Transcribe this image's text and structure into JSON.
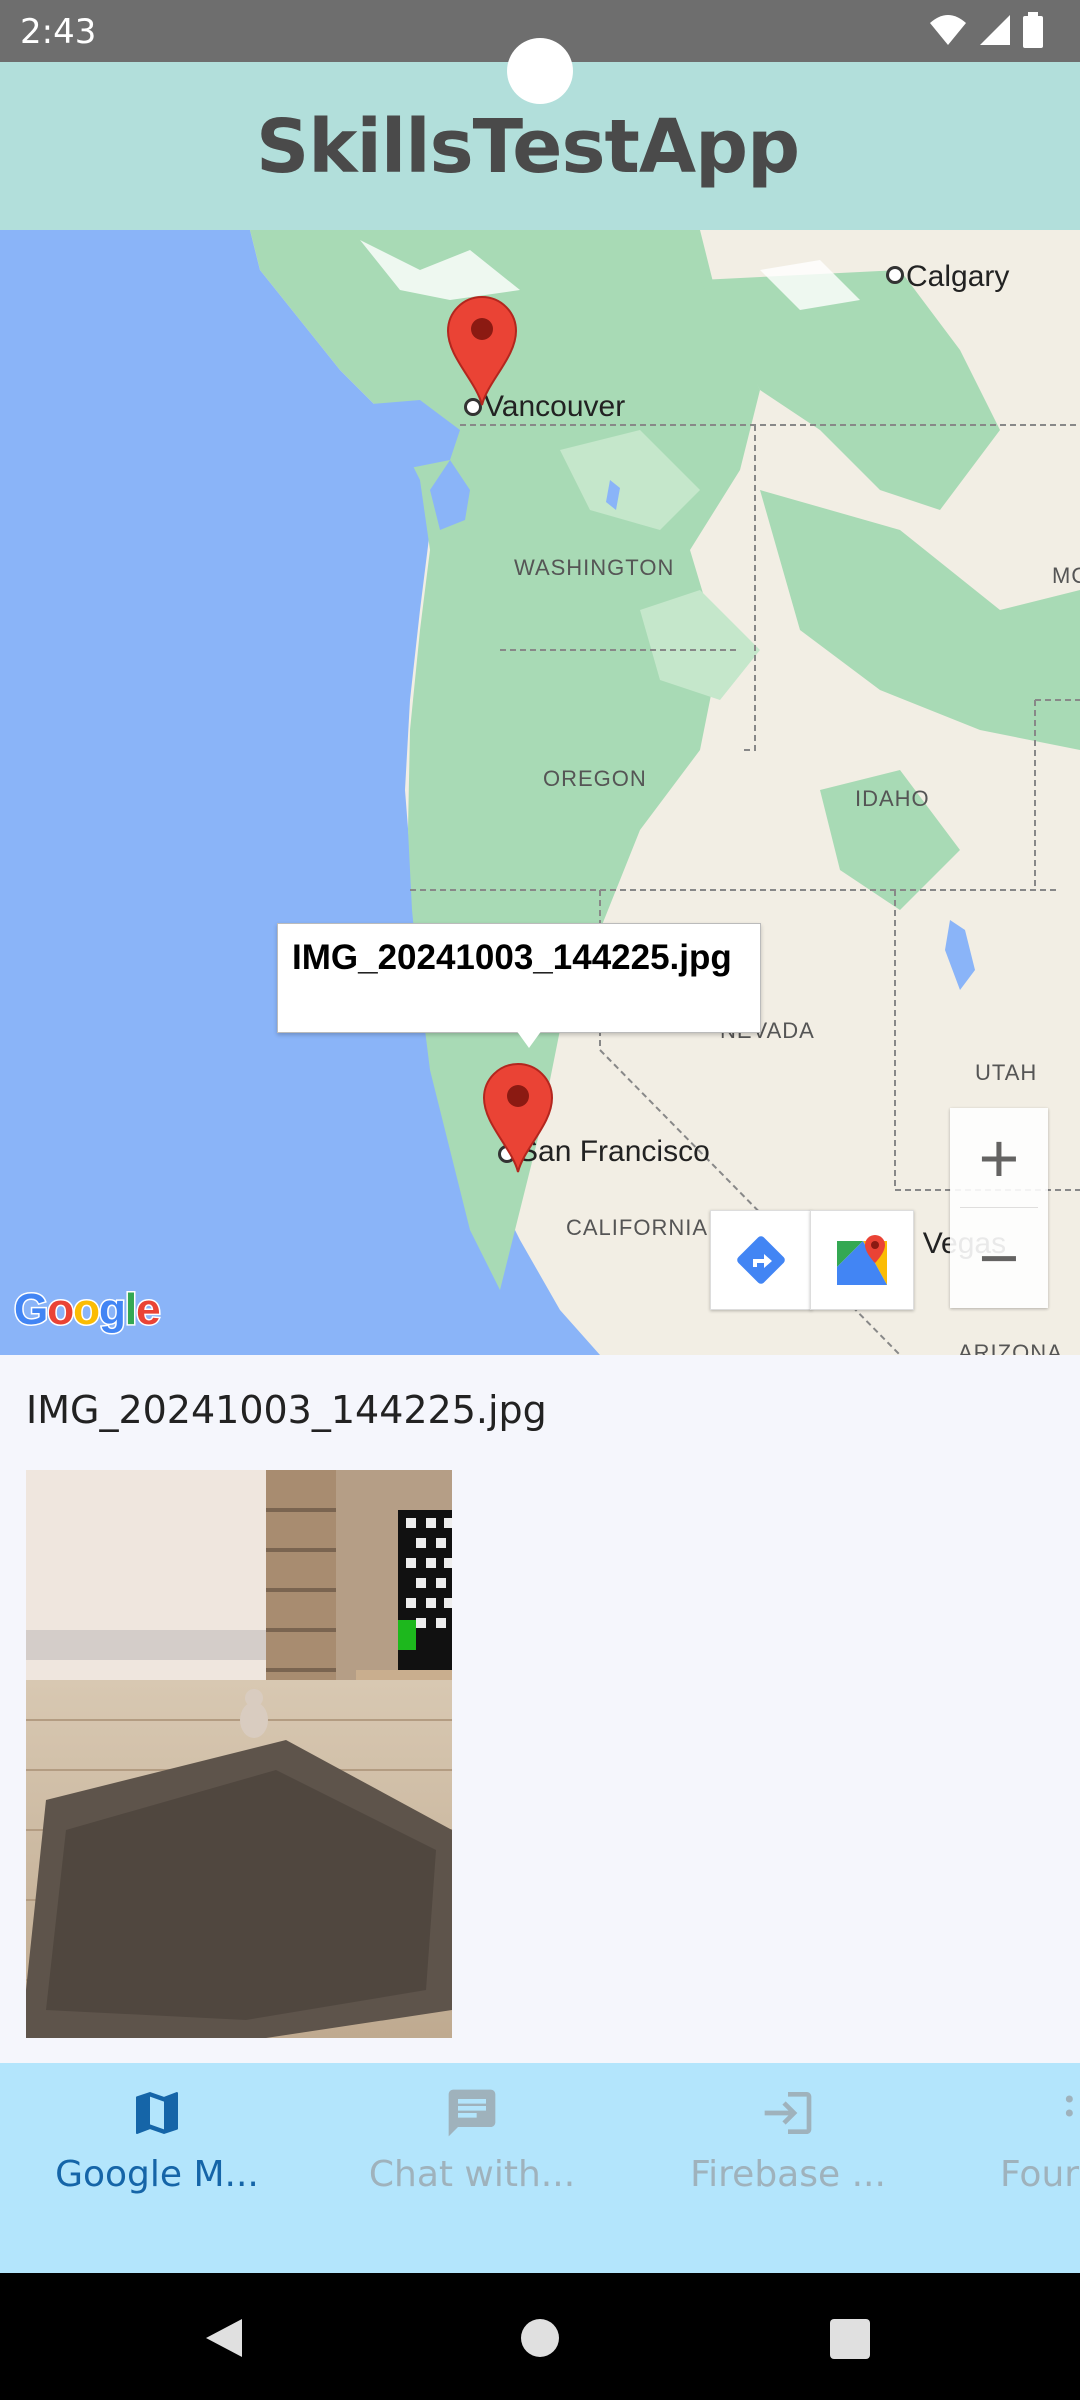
{
  "status_bar": {
    "time": "2:43"
  },
  "app_bar": {
    "title": "SkillsTestApp"
  },
  "map": {
    "cities": {
      "calgary": "Calgary",
      "vancouver": "Vancouver",
      "san_francisco": "San Francisco",
      "las_vegas": "Las Vegas"
    },
    "regions": {
      "washington": "WASHINGTON",
      "oregon": "OREGON",
      "idaho": "IDAHO",
      "nevada": "NEVADA",
      "utah": "UTAH",
      "california": "CALIFORNIA",
      "arizona": "ARIZONA",
      "montana_partial": "MO"
    },
    "info_window_title": "IMG_20241003_144225.jpg",
    "zoom_in_label": "+",
    "zoom_out_label": "−",
    "logo_text": "Google",
    "colors": {
      "water": "#8AB4F8",
      "land": "#F2EEE4",
      "forest": "#A8DAB5",
      "pin": "#EA4335"
    }
  },
  "content": {
    "filename": "IMG_20241003_144225.jpg"
  },
  "bottom_nav": {
    "items": [
      {
        "label": "Google M...",
        "icon": "map-icon",
        "active": true
      },
      {
        "label": "Chat with...",
        "icon": "chat-icon",
        "active": false
      },
      {
        "label": "Firebase ...",
        "icon": "login-icon",
        "active": false
      },
      {
        "label": "Four",
        "icon": "more-icon",
        "active": false
      }
    ]
  }
}
